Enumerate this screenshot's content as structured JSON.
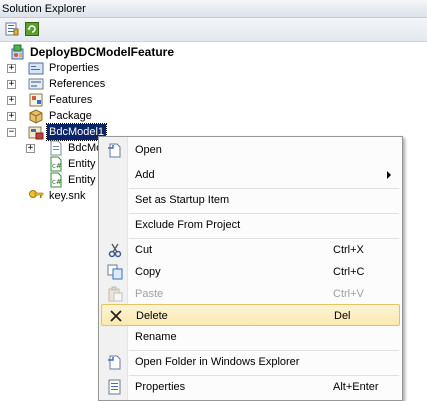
{
  "window": {
    "title": "Solution Explorer"
  },
  "toolbar": {
    "buttons": [
      {
        "icon": "properties-icon"
      },
      {
        "icon": "refresh-icon"
      }
    ]
  },
  "tree": {
    "project": "DeployBDCModelFeature",
    "items": [
      {
        "label": "Properties",
        "icon": "properties-folder-icon",
        "expander": "+"
      },
      {
        "label": "References",
        "icon": "references-icon",
        "expander": "+"
      },
      {
        "label": "Features",
        "icon": "features-icon",
        "expander": "+"
      },
      {
        "label": "Package",
        "icon": "package-icon",
        "expander": "+"
      },
      {
        "label": "BdcModel1",
        "icon": "bdc-model-icon",
        "expander": "−",
        "selected": true
      },
      {
        "label": "BdcMo",
        "icon": "file-icon",
        "expander": "+"
      },
      {
        "label": "Entity",
        "icon": "cs-file-icon"
      },
      {
        "label": "Entity",
        "icon": "cs-file-icon"
      },
      {
        "label": "key.snk",
        "icon": "key-icon"
      }
    ]
  },
  "context_menu": {
    "items": [
      {
        "label": "Open",
        "icon": "open-icon",
        "shortcut": ""
      },
      {
        "label": "Add",
        "icon": "",
        "shortcut": "",
        "submenu": true
      },
      {
        "label": "Set as Startup Item",
        "icon": "",
        "shortcut": ""
      },
      {
        "label": "Exclude From Project",
        "icon": "",
        "shortcut": ""
      },
      {
        "label": "Cut",
        "icon": "cut-icon",
        "shortcut": "Ctrl+X"
      },
      {
        "label": "Copy",
        "icon": "copy-icon",
        "shortcut": "Ctrl+C"
      },
      {
        "label": "Paste",
        "icon": "paste-icon",
        "shortcut": "Ctrl+V",
        "disabled": true
      },
      {
        "label": "Delete",
        "icon": "delete-icon",
        "shortcut": "Del",
        "highlighted": true
      },
      {
        "label": "Rename",
        "icon": "",
        "shortcut": ""
      },
      {
        "label": "Open Folder in Windows Explorer",
        "icon": "open-folder-icon",
        "shortcut": ""
      },
      {
        "label": "Properties",
        "icon": "properties-icon",
        "shortcut": "Alt+Enter"
      }
    ]
  },
  "colors": {
    "selection": "#0a246a",
    "menu_highlight": "#fbe9b0",
    "menu_highlight_border": "#e5c365"
  }
}
